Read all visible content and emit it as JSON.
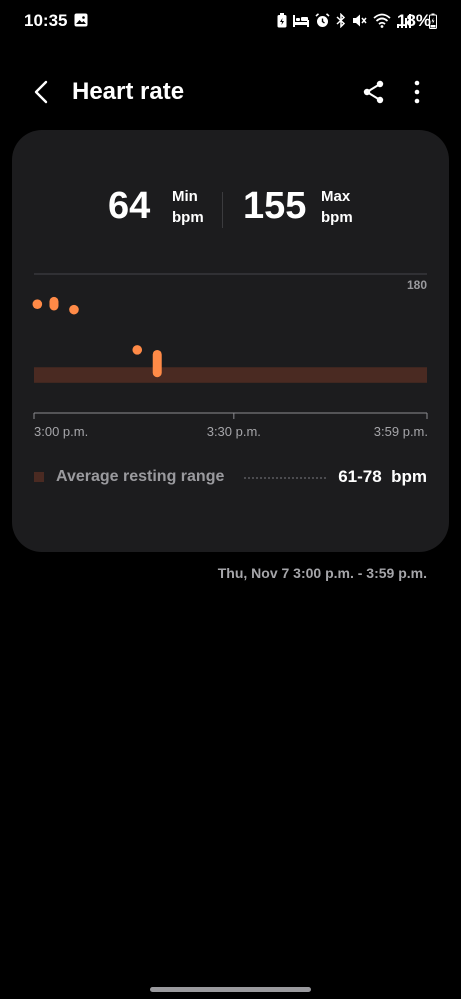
{
  "status_bar": {
    "time": "10:35",
    "battery": "18%",
    "icons": [
      "gallery-icon",
      "battery-saver-icon",
      "sleep-icon",
      "alarm-icon",
      "bluetooth-icon",
      "mute-icon",
      "wifi-icon",
      "signal-icon",
      "battery-icon"
    ]
  },
  "header": {
    "title": "Heart rate"
  },
  "summary": {
    "min_value": "64",
    "min_label": "Min",
    "min_unit": "bpm",
    "max_value": "155",
    "max_label": "Max",
    "max_unit": "bpm"
  },
  "chart_data": {
    "type": "scatter",
    "y_max_label": "180",
    "ylim": [
      40,
      180
    ],
    "x_tick_labels": [
      "3:00 p.m.",
      "3:30 p.m.",
      "3:59 p.m."
    ],
    "xlim_minutes": [
      0,
      59
    ],
    "resting_range": [
      61,
      78
    ],
    "points": [
      {
        "x": 0.5,
        "y": 147
      },
      {
        "x": 3,
        "y": 145,
        "y2": 150
      },
      {
        "x": 6,
        "y": 141
      },
      {
        "x": 15.5,
        "y": 97
      },
      {
        "x": 18.5,
        "y": 72,
        "y2": 92
      }
    ],
    "colors": {
      "point": "#ff8a47",
      "resting_band": "#4a2a22",
      "axis": "#8c8c90",
      "gridline": "#45454a"
    }
  },
  "legend": {
    "label": "Average resting range",
    "value": "61-78  bpm"
  },
  "date_range": "Thu, Nov 7 3:00 p.m. - 3:59 p.m."
}
